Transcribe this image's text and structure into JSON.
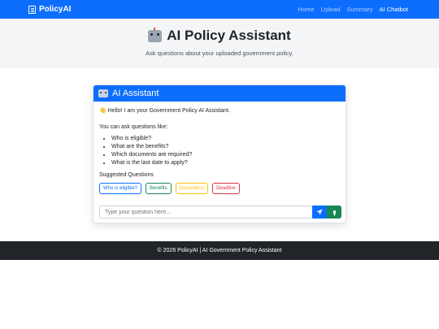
{
  "navbar": {
    "brand": "PolicyAI",
    "links": [
      "Home",
      "Upload",
      "Summary",
      "AI Chatbot"
    ],
    "active_link": "AI Chatbot"
  },
  "hero": {
    "title": "AI Policy Assistant",
    "subtitle": "Ask questions about your uploaded government policy."
  },
  "chat": {
    "header_title": "AI Assistant",
    "greeting": "Hello! I am your Government Policy AI Assistant.",
    "prompt": "You can ask questions like:",
    "example_questions": [
      "Who is eligible?",
      "What are the benefits?",
      "Which documents are required?",
      "What is the last date to apply?"
    ],
    "suggested_label": "Suggested Questions",
    "suggestions": [
      "Who is eligible?",
      "Benefits",
      "Documents",
      "Deadline"
    ],
    "input_placeholder": "Type your question here..."
  },
  "footer": {
    "text": "© 2026 PolicyAI | AI Government Policy Assistant"
  },
  "colors": {
    "primary": "#0d6efd",
    "success": "#198754",
    "warning": "#ffc107",
    "danger": "#dc3545",
    "footer": "#212529"
  }
}
